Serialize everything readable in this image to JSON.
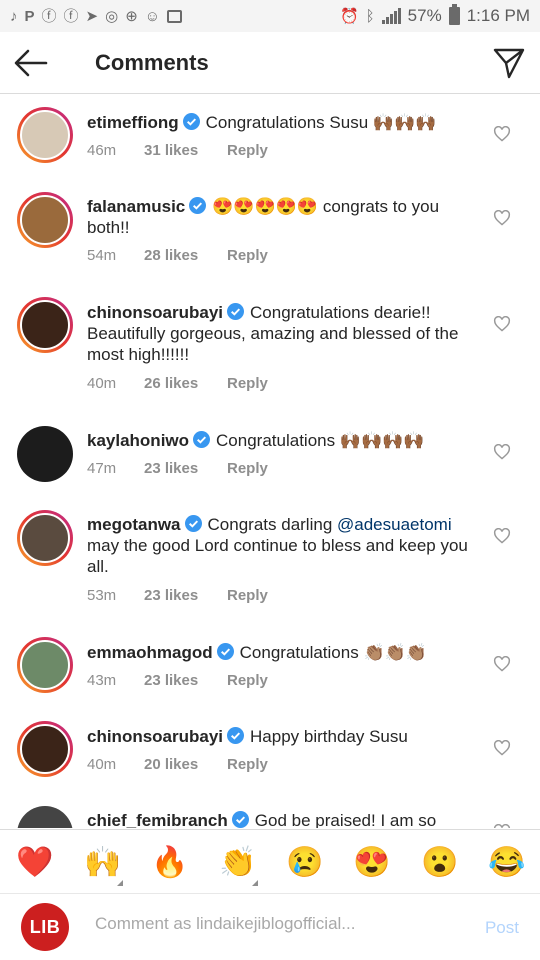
{
  "status_bar": {
    "battery_percent": "57%",
    "time": "1:16 PM"
  },
  "header": {
    "title": "Comments"
  },
  "comments": [
    {
      "username": "etimeffiong",
      "text": "Congratulations Susu 🙌🏾🙌🏾🙌🏾",
      "time": "46m",
      "likes": "31 likes",
      "reply": "Reply",
      "avatar_color": "#d7c9b6"
    },
    {
      "username": "falanamusic",
      "text": "😍😍😍😍😍 congrats to you both!!",
      "time": "54m",
      "likes": "28 likes",
      "reply": "Reply",
      "avatar_color": "#9a6a3c"
    },
    {
      "username": "chinonsoarubayi",
      "text": "Congratulations dearie!! Beautifully gorgeous, amazing and blessed of the most high!!!!!!",
      "time": "40m",
      "likes": "26 likes",
      "reply": "Reply",
      "avatar_color": "#3b2418"
    },
    {
      "username": "kaylahoniwo",
      "text": "Congratulations 🙌🏾🙌🏾🙌🏾🙌🏾",
      "time": "47m",
      "likes": "23 likes",
      "reply": "Reply",
      "avatar_color": "#1c1c1c"
    },
    {
      "username": "megotanwa",
      "text_before": "Congrats darling ",
      "mention": "@adesuaetomi",
      "text_after": " may the good Lord continue to bless and keep you all.",
      "time": "53m",
      "likes": "23 likes",
      "reply": "Reply",
      "avatar_color": "#5a4b3f"
    },
    {
      "username": "emmaohmagod",
      "text": "Congratulations 👏🏽👏🏽👏🏽",
      "time": "43m",
      "likes": "23 likes",
      "reply": "Reply",
      "avatar_color": "#6d8a68"
    },
    {
      "username": "chinonsoarubayi",
      "text": "Happy birthday Susu",
      "time": "40m",
      "likes": "20 likes",
      "reply": "Reply",
      "avatar_color": "#3b2418"
    },
    {
      "username": "chief_femibranch",
      "text": "God be praised! I am so",
      "avatar_color": "#444444"
    }
  ],
  "reactions": [
    "❤️",
    "🙌",
    "🔥",
    "👏",
    "😢",
    "😍",
    "😮",
    "😂"
  ],
  "composer": {
    "avatar_label": "LIB",
    "placeholder": "Comment as lindaikejiblogofficial...",
    "post_label": "Post"
  }
}
